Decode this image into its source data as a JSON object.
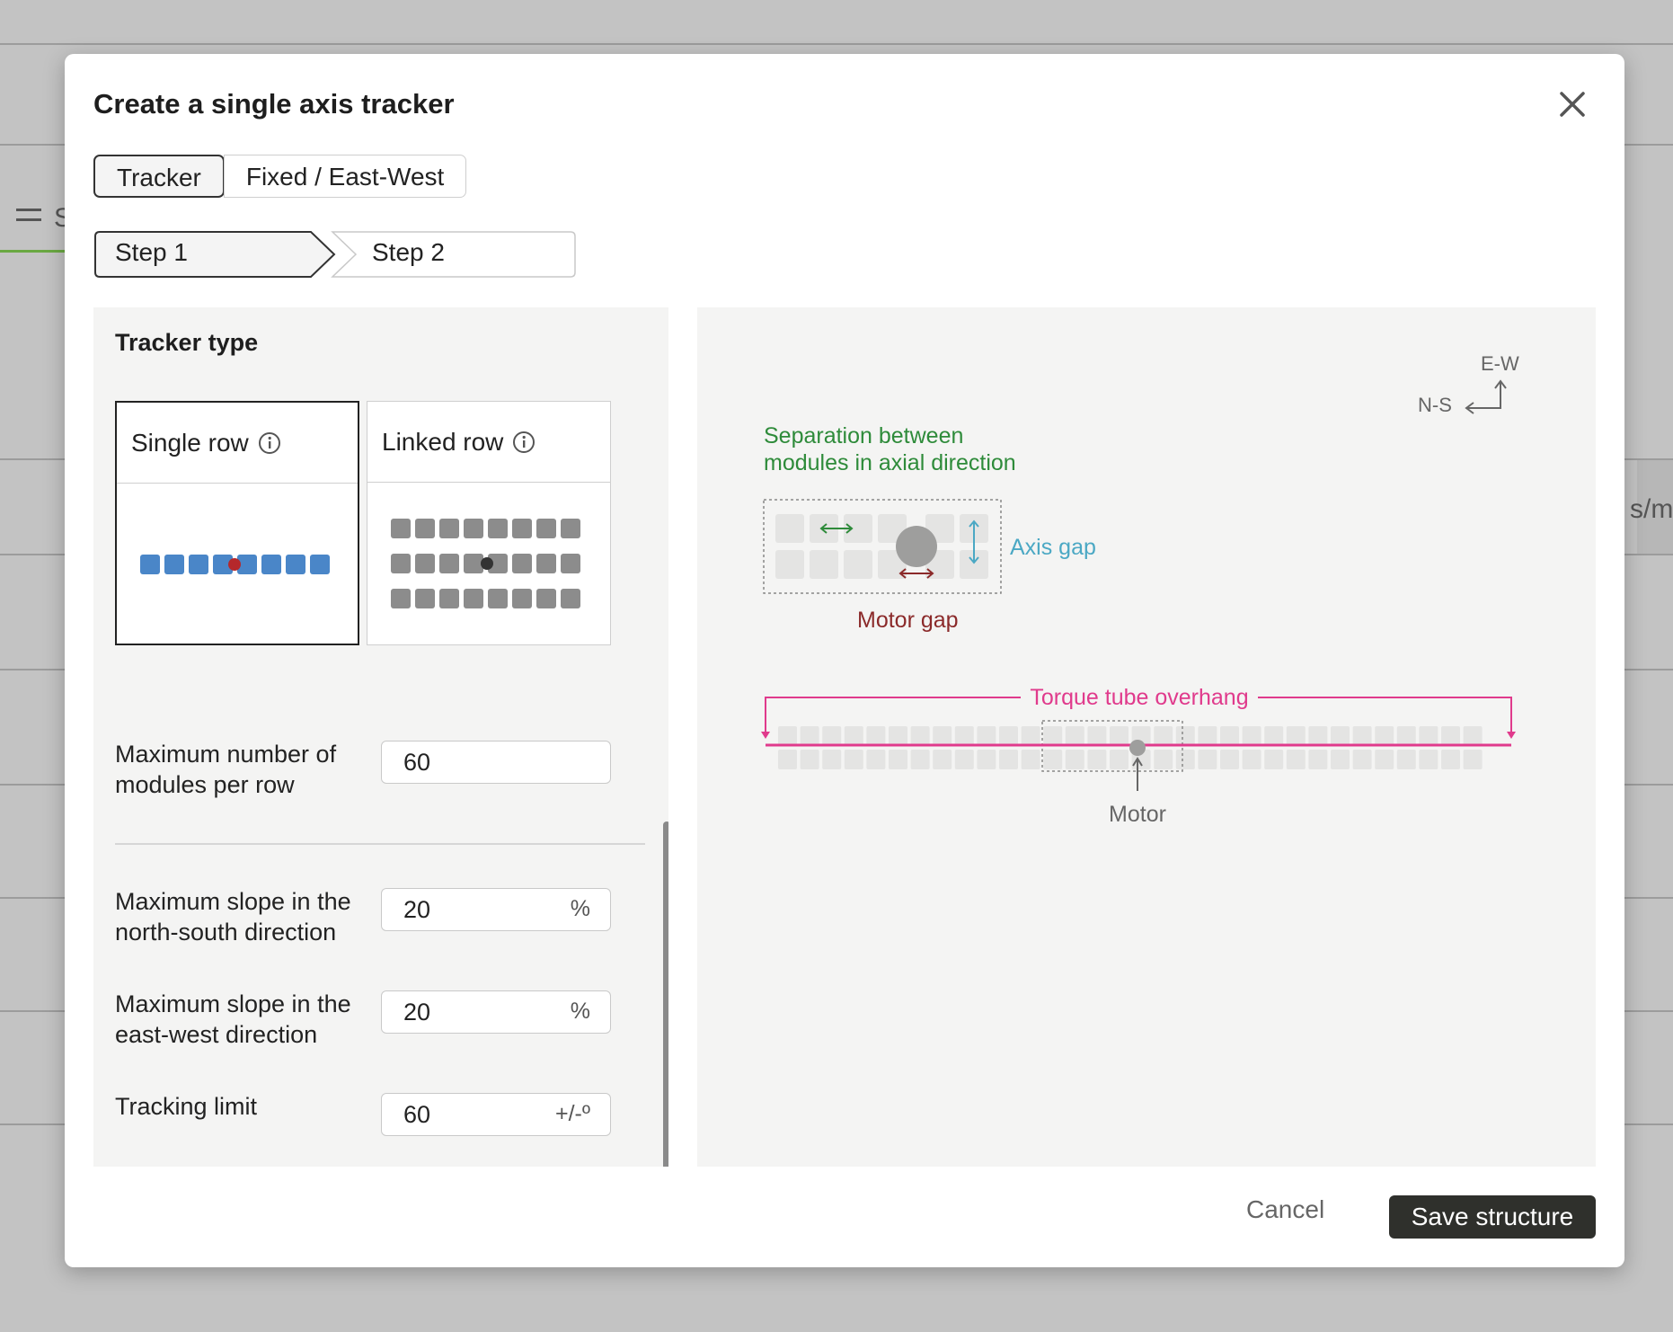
{
  "background": {
    "left_item_label": "S",
    "right_fragment": "s/m"
  },
  "dialog": {
    "title": "Create a single axis tracker"
  },
  "tabs": [
    {
      "label": "Tracker",
      "active": true
    },
    {
      "label": "Fixed / East-West",
      "active": false
    }
  ],
  "steps": [
    {
      "label": "Step 1",
      "active": true
    },
    {
      "label": "Step 2",
      "active": false
    }
  ],
  "form": {
    "section_title": "Tracker type",
    "tracker_types": [
      {
        "label": "Single row",
        "selected": true
      },
      {
        "label": "Linked row",
        "selected": false
      }
    ],
    "fields": {
      "max_modules": {
        "label_line1": "Maximum number of",
        "label_line2": "modules per row",
        "value": "60"
      },
      "slope_ns": {
        "label_line1": "Maximum slope in the",
        "label_line2": "north-south direction",
        "value": "20",
        "unit": "%"
      },
      "slope_ew": {
        "label_line1": "Maximum slope in the",
        "label_line2": "east-west direction",
        "value": "20",
        "unit": "%"
      },
      "tracking_limit": {
        "label": "Tracking limit",
        "value": "60",
        "unit": "+/-º"
      }
    }
  },
  "diagram": {
    "compass_ew": "E-W",
    "compass_ns": "N-S",
    "separation_line1": "Separation between",
    "separation_line2": "modules in axial direction",
    "axis_gap": "Axis gap",
    "motor_gap": "Motor gap",
    "torque_tube_overhang": "Torque tube overhang",
    "motor": "Motor"
  },
  "footer": {
    "cancel": "Cancel",
    "save": "Save structure"
  },
  "colors": {
    "module_blue": "#4a86c8",
    "motor_red": "#b5282b",
    "linked_module": "#8c8c8c",
    "separation_green": "#2e8b3a",
    "axis_gap_blue": "#4ba8c4",
    "motor_gap_red": "#8b2a2a",
    "torque_pink": "#e03a8c",
    "save_button": "#2f302c"
  }
}
